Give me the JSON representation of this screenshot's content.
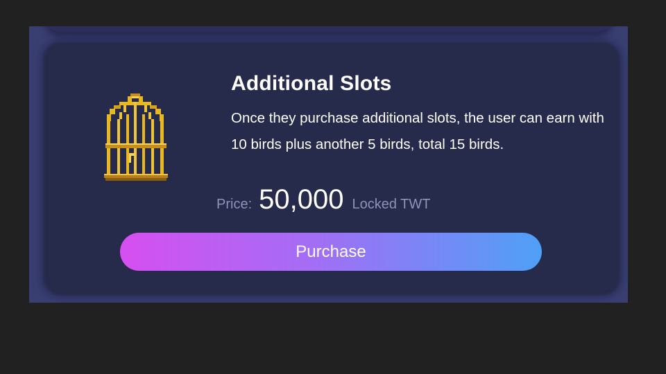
{
  "card": {
    "icon": "bird-cage-icon",
    "title": "Additional Slots",
    "description": "Once they purchase additional slots, the user can earn with 10 birds plus another 5 birds, total 15 birds.",
    "price": {
      "label": "Price:",
      "value": "50,000",
      "unit": "Locked TWT"
    },
    "purchase_label": "Purchase"
  },
  "colors": {
    "page_background": "#212121",
    "panel_background": "#3a3f72",
    "card_background": "#262a4b",
    "button_gradient_start": "#d64ff0",
    "button_gradient_end": "#4fa0f7",
    "icon_gold": "#e8b81e"
  }
}
